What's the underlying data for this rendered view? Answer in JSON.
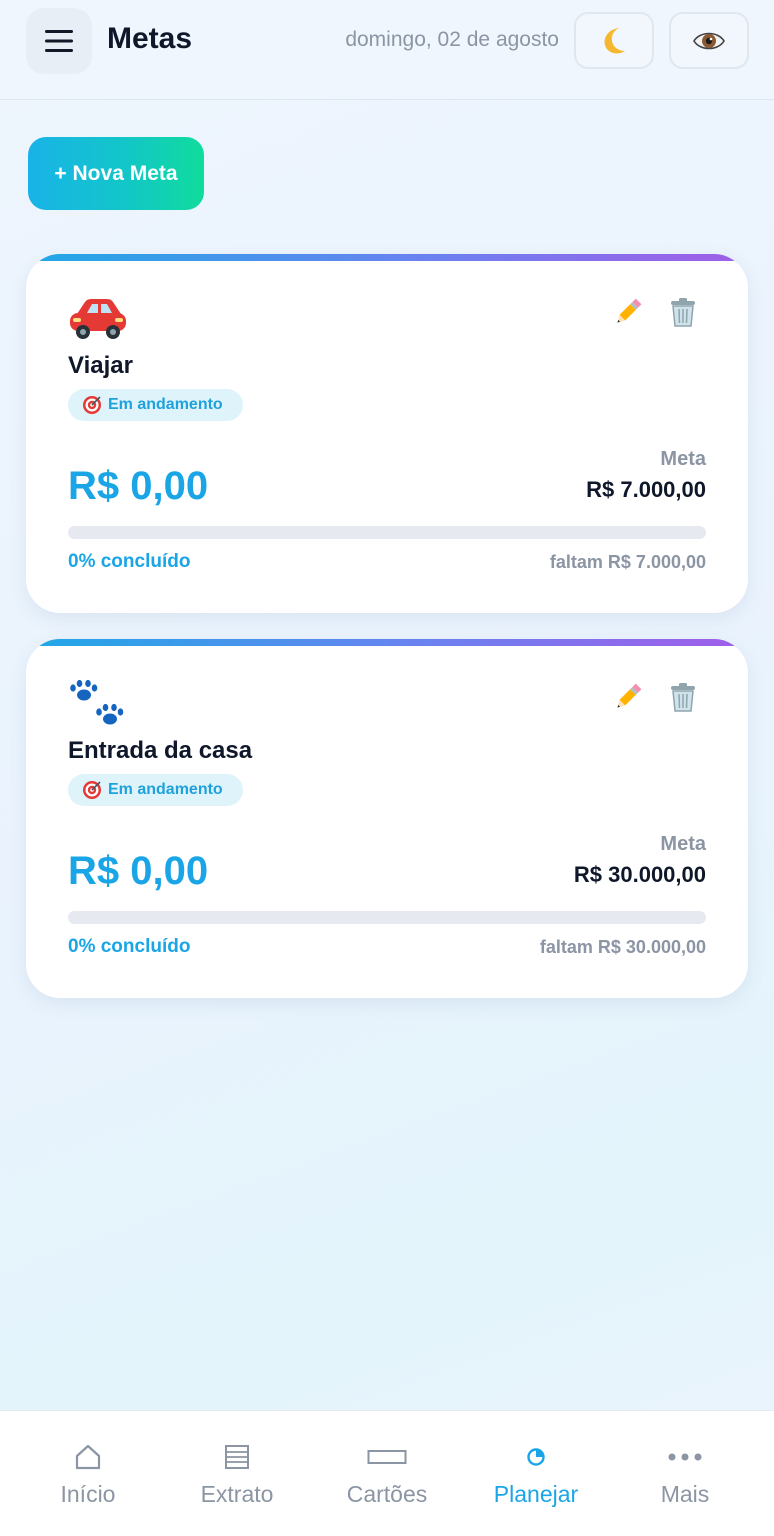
{
  "header": {
    "title": "Metas",
    "date": "domingo, 02 de agosto",
    "icons": {
      "menu": "hamburger-menu-icon",
      "theme": "crescent-moon-icon",
      "visibility": "eye-icon"
    }
  },
  "actions": {
    "new_goal_label": "+ Nova Meta"
  },
  "goals": [
    {
      "emoji": "red-car-icon",
      "name": "Viajar",
      "status": "Em andamento",
      "saved": "R$ 0,00",
      "target_label": "Meta",
      "target": "R$ 7.000,00",
      "progress_percent": 0,
      "progress_text": "0% concluído",
      "remaining": "faltam R$ 7.000,00"
    },
    {
      "emoji": "paw-prints-icon",
      "name": "Entrada da casa",
      "status": "Em andamento",
      "saved": "R$ 0,00",
      "target_label": "Meta",
      "target": "R$ 30.000,00",
      "progress_percent": 0,
      "progress_text": "0% concluído",
      "remaining": "faltam R$ 30.000,00"
    }
  ],
  "nav": {
    "items": [
      {
        "label": "Início",
        "icon": "home-icon",
        "active": false
      },
      {
        "label": "Extrato",
        "icon": "list-icon",
        "active": false
      },
      {
        "label": "Cartões",
        "icon": "card-icon",
        "active": false
      },
      {
        "label": "Planejar",
        "icon": "pie-chart-icon",
        "active": true
      },
      {
        "label": "Mais",
        "icon": "more-dots-icon",
        "active": false
      }
    ]
  },
  "colors": {
    "accent": "#1aa6e6",
    "title": "#0f172a",
    "muted": "#8b95a3",
    "button_gradient_start": "#19b3e8",
    "button_gradient_end": "#10dc9c",
    "card_bar_start": "#1fa8e6",
    "card_bar_end": "#a15de8",
    "badge_bg": "#dff3fb"
  }
}
